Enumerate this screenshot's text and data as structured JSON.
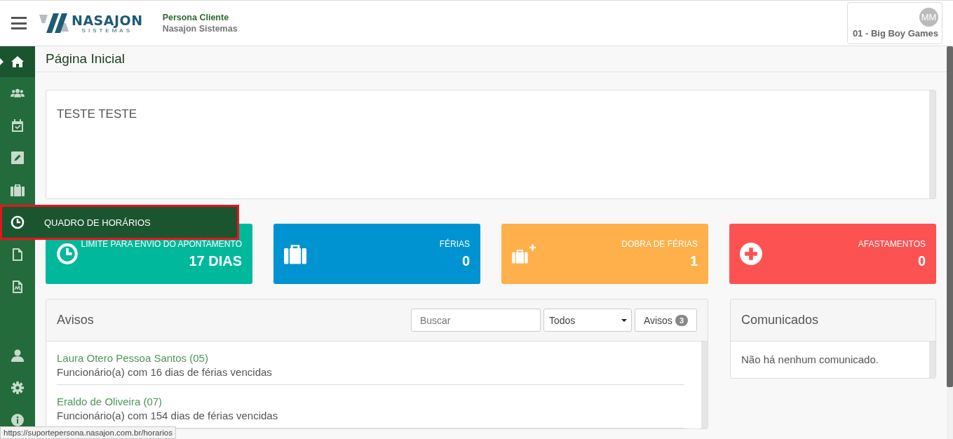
{
  "header": {
    "app_name": "Persona Cliente",
    "company": "Nasajon Sistemas",
    "logo_text": "NASAJON",
    "logo_subtext": "SISTEMAS",
    "avatar_initials": "MM",
    "account": "01 - Big Boy Games"
  },
  "sidebar": {
    "items": [
      {
        "kind": "home",
        "selected": true
      },
      {
        "kind": "users",
        "selected": false
      },
      {
        "kind": "calendar",
        "selected": false
      },
      {
        "kind": "edit",
        "selected": false
      },
      {
        "kind": "briefcase",
        "selected": false
      },
      {
        "kind": "clock",
        "selected": false,
        "tooltip": "QUADRO DE HORÁRIOS"
      },
      {
        "kind": "file",
        "selected": false
      },
      {
        "kind": "report",
        "selected": false
      }
    ],
    "bottom_items": [
      {
        "kind": "user"
      },
      {
        "kind": "gear"
      },
      {
        "kind": "info"
      }
    ]
  },
  "page_title": "Página Inicial",
  "welcome_text": "TESTE TESTE",
  "stat_cards": [
    {
      "kind": "clock",
      "label": "LIMITE PARA ENVIO DO APONTAMENTO",
      "value": "17 DIAS",
      "color": "#00b89c"
    },
    {
      "kind": "briefcase",
      "label": "FÉRIAS",
      "value": "0",
      "color": "#0093d1"
    },
    {
      "kind": "briefcase-plus",
      "label": "DOBRA DE FÉRIAS",
      "value": "1",
      "color": "#ffb04a"
    },
    {
      "kind": "plus",
      "label": "AFASTAMENTOS",
      "value": "0",
      "color": "#fc5252"
    }
  ],
  "notices": {
    "title": "Avisos",
    "search": {
      "placeholder": "Buscar"
    },
    "filter": "Todos",
    "button": "Avisos",
    "count": "3",
    "items": [
      {
        "name": "Laura Otero Pessoa Santos (05)",
        "text": "Funcionário(a) com 16 dias de férias vencidas"
      },
      {
        "name": "Eraldo de Oliveira (07)",
        "text": "Funcionário(a) com 154 dias de férias vencidas"
      }
    ]
  },
  "announcements": {
    "title": "Comunicados",
    "empty_text": "Não há nenhum comunicado."
  },
  "status_url": "https://suportepersona.nasajon.com.br/horarios"
}
